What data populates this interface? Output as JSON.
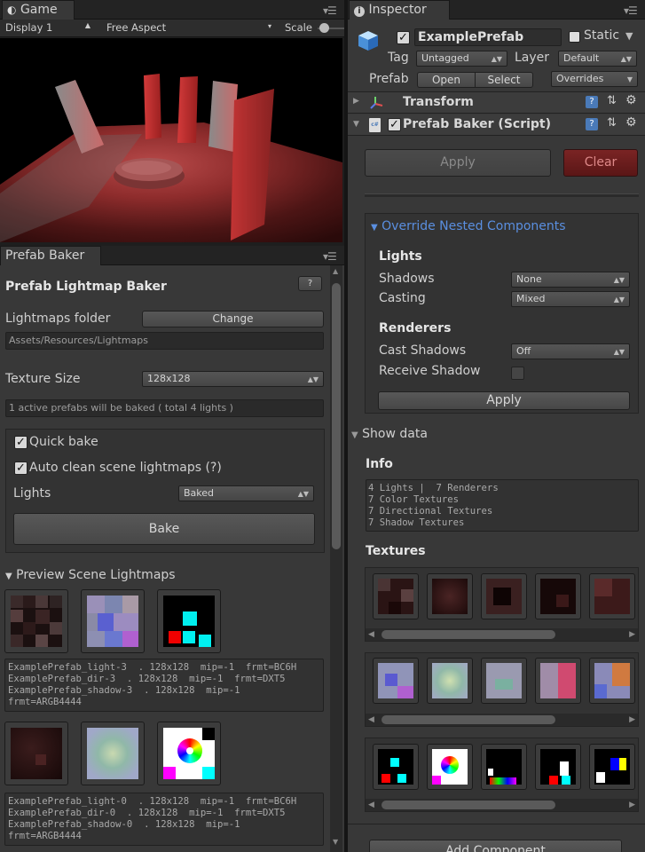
{
  "game": {
    "tab_label": "Game",
    "display": "Display 1",
    "aspect": "Free Aspect",
    "scale_label": "Scale"
  },
  "baker": {
    "tab_label": "Prefab Baker",
    "title": "Prefab Lightmap Baker",
    "help": "?",
    "lightmaps_folder_label": "Lightmaps folder",
    "change_button": "Change",
    "folder_path": "Assets/Resources/Lightmaps",
    "texture_size_label": "Texture Size",
    "texture_size_value": "128x128",
    "status_text": "1 active prefabs will be baked ( total 4 lights )",
    "quick_bake_label": "Quick bake",
    "auto_clean_label": "Auto clean scene lightmaps (?)",
    "lights_label": "Lights",
    "lights_value": "Baked",
    "bake_button": "Bake",
    "preview_label": "Preview Scene Lightmaps",
    "preview_info_1": "ExamplePrefab_light-3  . 128x128  mip=-1  frmt=BC6H\nExamplePrefab_dir-3  . 128x128  mip=-1  frmt=DXT5\nExamplePrefab_shadow-3  . 128x128  mip=-1\nfrmt=ARGB4444",
    "preview_info_2": "ExamplePrefab_light-0  . 128x128  mip=-1  frmt=BC6H\nExamplePrefab_dir-0  . 128x128  mip=-1  frmt=DXT5\nExamplePrefab_shadow-0  . 128x128  mip=-1\nfrmt=ARGB4444"
  },
  "inspector": {
    "tab_label": "Inspector",
    "object_name": "ExamplePrefab",
    "static_label": "Static",
    "tag_label": "Tag",
    "tag_value": "Untagged",
    "layer_label": "Layer",
    "layer_value": "Default",
    "prefab_label": "Prefab",
    "open_button": "Open",
    "select_button": "Select",
    "overrides_value": "Overrides",
    "transform_label": "Transform",
    "script_label": "Prefab Baker (Script)",
    "apply_top": "Apply",
    "clear_button": "Clear",
    "override_nested": "Override Nested Components",
    "lights_header": "Lights",
    "shadows_label": "Shadows",
    "shadows_value": "None",
    "casting_label": "Casting",
    "casting_value": "Mixed",
    "renderers_header": "Renderers",
    "cast_shadows_label": "Cast Shadows",
    "cast_shadows_value": "Off",
    "receive_shadow_label": "Receive Shadow",
    "apply_inner": "Apply",
    "show_data": "Show data",
    "info_header": "Info",
    "info_text": "4 Lights |  7 Renderers\n7 Color Textures\n7 Directional Textures\n7 Shadow Textures",
    "textures_header": "Textures",
    "add_component": "Add Component"
  },
  "colors": {
    "accent_blue": "#5a8fe0",
    "clear_red": "#6e1d1d"
  }
}
